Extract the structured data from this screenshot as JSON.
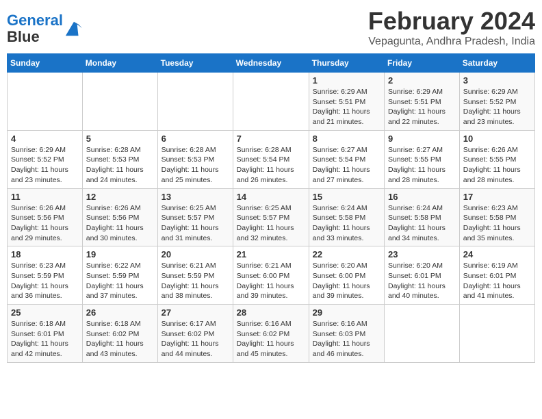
{
  "header": {
    "logo_line1": "General",
    "logo_line2": "Blue",
    "month_year": "February 2024",
    "location": "Vepagunta, Andhra Pradesh, India"
  },
  "days_of_week": [
    "Sunday",
    "Monday",
    "Tuesday",
    "Wednesday",
    "Thursday",
    "Friday",
    "Saturday"
  ],
  "weeks": [
    [
      {
        "day": "",
        "content": ""
      },
      {
        "day": "",
        "content": ""
      },
      {
        "day": "",
        "content": ""
      },
      {
        "day": "",
        "content": ""
      },
      {
        "day": "1",
        "content": "Sunrise: 6:29 AM\nSunset: 5:51 PM\nDaylight: 11 hours\nand 21 minutes."
      },
      {
        "day": "2",
        "content": "Sunrise: 6:29 AM\nSunset: 5:51 PM\nDaylight: 11 hours\nand 22 minutes."
      },
      {
        "day": "3",
        "content": "Sunrise: 6:29 AM\nSunset: 5:52 PM\nDaylight: 11 hours\nand 23 minutes."
      }
    ],
    [
      {
        "day": "4",
        "content": "Sunrise: 6:29 AM\nSunset: 5:52 PM\nDaylight: 11 hours\nand 23 minutes."
      },
      {
        "day": "5",
        "content": "Sunrise: 6:28 AM\nSunset: 5:53 PM\nDaylight: 11 hours\nand 24 minutes."
      },
      {
        "day": "6",
        "content": "Sunrise: 6:28 AM\nSunset: 5:53 PM\nDaylight: 11 hours\nand 25 minutes."
      },
      {
        "day": "7",
        "content": "Sunrise: 6:28 AM\nSunset: 5:54 PM\nDaylight: 11 hours\nand 26 minutes."
      },
      {
        "day": "8",
        "content": "Sunrise: 6:27 AM\nSunset: 5:54 PM\nDaylight: 11 hours\nand 27 minutes."
      },
      {
        "day": "9",
        "content": "Sunrise: 6:27 AM\nSunset: 5:55 PM\nDaylight: 11 hours\nand 28 minutes."
      },
      {
        "day": "10",
        "content": "Sunrise: 6:26 AM\nSunset: 5:55 PM\nDaylight: 11 hours\nand 28 minutes."
      }
    ],
    [
      {
        "day": "11",
        "content": "Sunrise: 6:26 AM\nSunset: 5:56 PM\nDaylight: 11 hours\nand 29 minutes."
      },
      {
        "day": "12",
        "content": "Sunrise: 6:26 AM\nSunset: 5:56 PM\nDaylight: 11 hours\nand 30 minutes."
      },
      {
        "day": "13",
        "content": "Sunrise: 6:25 AM\nSunset: 5:57 PM\nDaylight: 11 hours\nand 31 minutes."
      },
      {
        "day": "14",
        "content": "Sunrise: 6:25 AM\nSunset: 5:57 PM\nDaylight: 11 hours\nand 32 minutes."
      },
      {
        "day": "15",
        "content": "Sunrise: 6:24 AM\nSunset: 5:58 PM\nDaylight: 11 hours\nand 33 minutes."
      },
      {
        "day": "16",
        "content": "Sunrise: 6:24 AM\nSunset: 5:58 PM\nDaylight: 11 hours\nand 34 minutes."
      },
      {
        "day": "17",
        "content": "Sunrise: 6:23 AM\nSunset: 5:58 PM\nDaylight: 11 hours\nand 35 minutes."
      }
    ],
    [
      {
        "day": "18",
        "content": "Sunrise: 6:23 AM\nSunset: 5:59 PM\nDaylight: 11 hours\nand 36 minutes."
      },
      {
        "day": "19",
        "content": "Sunrise: 6:22 AM\nSunset: 5:59 PM\nDaylight: 11 hours\nand 37 minutes."
      },
      {
        "day": "20",
        "content": "Sunrise: 6:21 AM\nSunset: 5:59 PM\nDaylight: 11 hours\nand 38 minutes."
      },
      {
        "day": "21",
        "content": "Sunrise: 6:21 AM\nSunset: 6:00 PM\nDaylight: 11 hours\nand 39 minutes."
      },
      {
        "day": "22",
        "content": "Sunrise: 6:20 AM\nSunset: 6:00 PM\nDaylight: 11 hours\nand 39 minutes."
      },
      {
        "day": "23",
        "content": "Sunrise: 6:20 AM\nSunset: 6:01 PM\nDaylight: 11 hours\nand 40 minutes."
      },
      {
        "day": "24",
        "content": "Sunrise: 6:19 AM\nSunset: 6:01 PM\nDaylight: 11 hours\nand 41 minutes."
      }
    ],
    [
      {
        "day": "25",
        "content": "Sunrise: 6:18 AM\nSunset: 6:01 PM\nDaylight: 11 hours\nand 42 minutes."
      },
      {
        "day": "26",
        "content": "Sunrise: 6:18 AM\nSunset: 6:02 PM\nDaylight: 11 hours\nand 43 minutes."
      },
      {
        "day": "27",
        "content": "Sunrise: 6:17 AM\nSunset: 6:02 PM\nDaylight: 11 hours\nand 44 minutes."
      },
      {
        "day": "28",
        "content": "Sunrise: 6:16 AM\nSunset: 6:02 PM\nDaylight: 11 hours\nand 45 minutes."
      },
      {
        "day": "29",
        "content": "Sunrise: 6:16 AM\nSunset: 6:03 PM\nDaylight: 11 hours\nand 46 minutes."
      },
      {
        "day": "",
        "content": ""
      },
      {
        "day": "",
        "content": ""
      }
    ]
  ]
}
